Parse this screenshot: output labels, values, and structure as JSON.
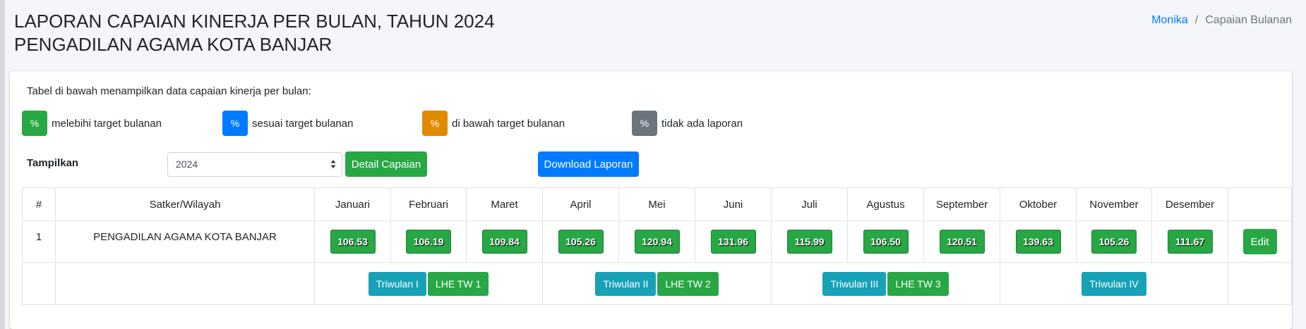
{
  "header": {
    "title_line1": "LAPORAN CAPAIAN KINERJA PER BULAN, TAHUN 2024",
    "title_line2": "PENGADILAN AGAMA KOTA BANJAR",
    "breadcrumb": {
      "home": "Monika",
      "separator": "/",
      "current": "Capaian Bulanan"
    }
  },
  "intro_text": "Tabel di bawah menampilkan data capaian kinerja per bulan:",
  "legend": [
    {
      "symbol": "%",
      "label": "melebihi target bulanan",
      "color": "#28a745"
    },
    {
      "symbol": "%",
      "label": "sesuai target bulanan",
      "color": "#007bff"
    },
    {
      "symbol": "%",
      "label": "di bawah target bulanan",
      "color": "#e08a00"
    },
    {
      "symbol": "%",
      "label": "tidak ada laporan",
      "color": "#6c757d"
    }
  ],
  "controls": {
    "label": "Tampilkan",
    "year_value": "2024",
    "detail_button": "Detail Capaian",
    "download_button": "Download Laporan"
  },
  "table": {
    "columns": [
      "#",
      "Satker/Wilayah",
      "Januari",
      "Februari",
      "Maret",
      "April",
      "Mei",
      "Juni",
      "Juli",
      "Agustus",
      "September",
      "Oktober",
      "November",
      "Desember",
      ""
    ],
    "rows": [
      {
        "no": "1",
        "satker": "PENGADILAN AGAMA KOTA BANJAR",
        "values": [
          "106.53",
          "106.19",
          "109.84",
          "105.26",
          "120.94",
          "131.96",
          "115.99",
          "106.50",
          "120.51",
          "139.63",
          "105.26",
          "111.67"
        ],
        "edit_label": "Edit"
      }
    ],
    "quarters": [
      {
        "triwulan": "Triwulan I",
        "lhe": "LHE TW 1"
      },
      {
        "triwulan": "Triwulan II",
        "lhe": "LHE TW 2"
      },
      {
        "triwulan": "Triwulan III",
        "lhe": "LHE TW 3"
      },
      {
        "triwulan": "Triwulan IV",
        "lhe": ""
      }
    ]
  }
}
